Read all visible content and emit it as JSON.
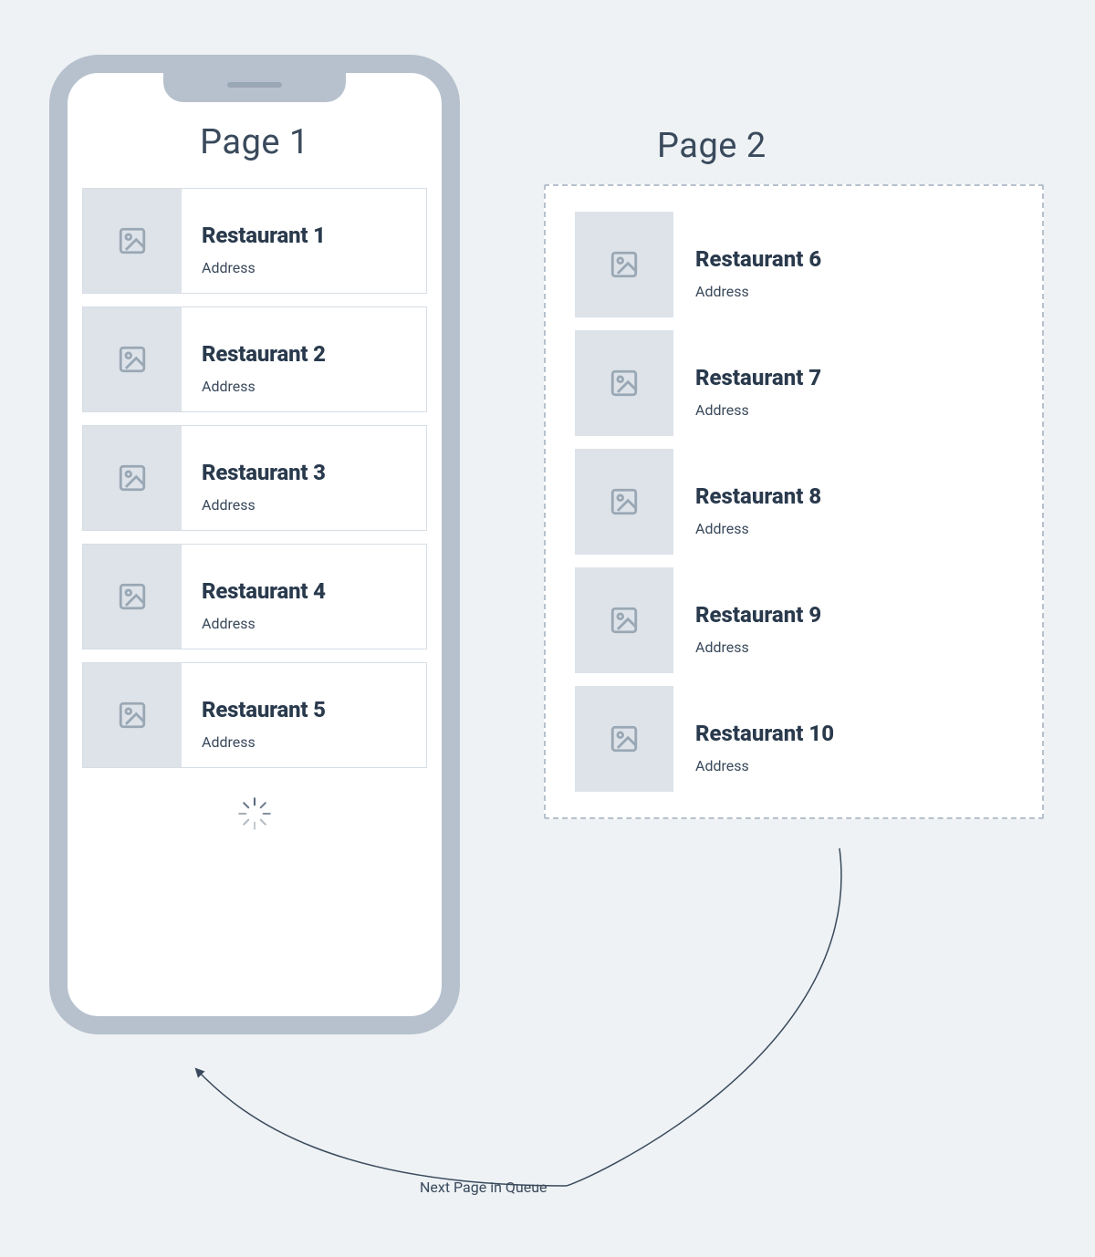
{
  "colors": {
    "bg": "#eef2f5",
    "ink": "#3a4a5c",
    "inkDark": "#2a3a4d",
    "frame": "#b6c1cd",
    "thumb": "#dde3e9",
    "border": "#d6dde4"
  },
  "page1": {
    "title": "Page 1",
    "items": [
      {
        "name": "Restaurant 1",
        "address": "Address"
      },
      {
        "name": "Restaurant 2",
        "address": "Address"
      },
      {
        "name": "Restaurant 3",
        "address": "Address"
      },
      {
        "name": "Restaurant 4",
        "address": "Address"
      },
      {
        "name": "Restaurant 5",
        "address": "Address"
      }
    ]
  },
  "page2": {
    "title": "Page 2",
    "items": [
      {
        "name": "Restaurant 6",
        "address": "Address"
      },
      {
        "name": "Restaurant 7",
        "address": "Address"
      },
      {
        "name": "Restaurant 8",
        "address": "Address"
      },
      {
        "name": "Restaurant 9",
        "address": "Address"
      },
      {
        "name": "Restaurant 10",
        "address": "Address"
      }
    ]
  },
  "caption": "Next Page in Queue",
  "icons": {
    "image": "image-placeholder-icon",
    "spinner": "loading-spinner-icon"
  }
}
